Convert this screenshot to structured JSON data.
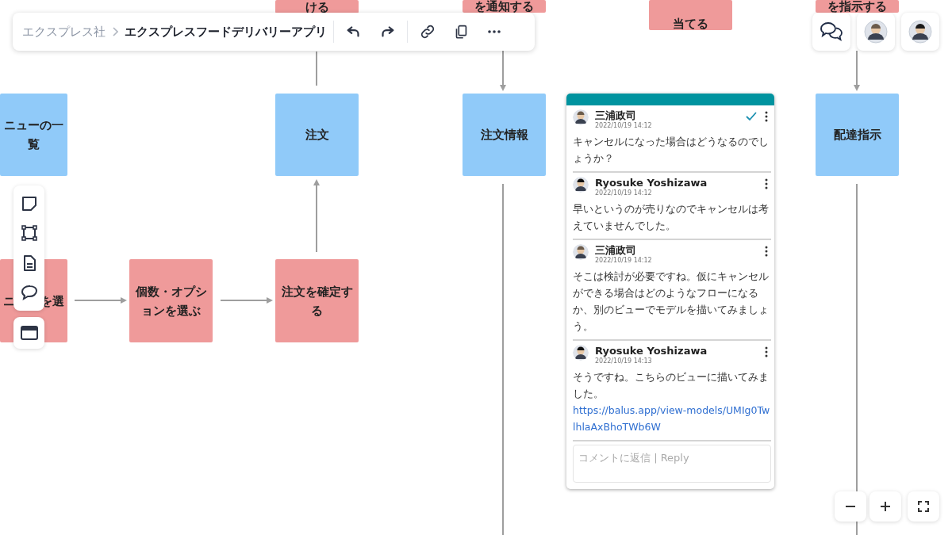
{
  "toolbar": {
    "workspace": "エクスプレス社",
    "title": "エクスプレスフードデリバリーアプリ"
  },
  "stickies": [
    {
      "text": "ける",
      "color": "#ef9a9a"
    },
    {
      "text": "を通知する",
      "color": "#ef9a9a"
    },
    {
      "text": "当てる",
      "color": "#ef9a9a"
    },
    {
      "text": "を指示する",
      "color": "#ef9a9a"
    },
    {
      "text": "ニューの一覧",
      "color": "#90caf9"
    },
    {
      "text": "注文",
      "color": "#90caf9"
    },
    {
      "text": "注文情報",
      "color": "#90caf9"
    },
    {
      "text": "配達指示",
      "color": "#90caf9"
    },
    {
      "text": "ニ",
      "text_2": "を選",
      "color": "#ef9a9a"
    },
    {
      "text": "個数・オプションを選ぶ",
      "color": "#ef9a9a"
    },
    {
      "text": "注文を確定する",
      "color": "#ef9a9a"
    }
  ],
  "comments": [
    {
      "author": "三浦政司",
      "time": "2022/10/19 14:12",
      "text": "キャンセルになった場合はどうなるのでしょうか？",
      "resolved": true
    },
    {
      "author": "Ryosuke Yoshizawa",
      "time": "2022/10/19 14:12",
      "text": "早いというのが売りなのでキャンセルは考えていませんでした。",
      "resolved": false
    },
    {
      "author": "三浦政司",
      "time": "2022/10/19 14:12",
      "text": "そこは検討が必要ですね。仮にキャンセルができる場合はどのようなフローになるか、別のビューでモデルを描いてみましょう。",
      "resolved": false
    },
    {
      "author": "Ryosuke Yoshizawa",
      "time": "2022/10/19 14:13",
      "text": "そうですね。こちらのビューに描いてみました。",
      "link": "https://balus.app/view-models/UMIg0TwlhlaAxBhoTWb6W",
      "resolved": false
    }
  ],
  "reply": {
    "placeholder": "コメントに返信 | Reply"
  }
}
